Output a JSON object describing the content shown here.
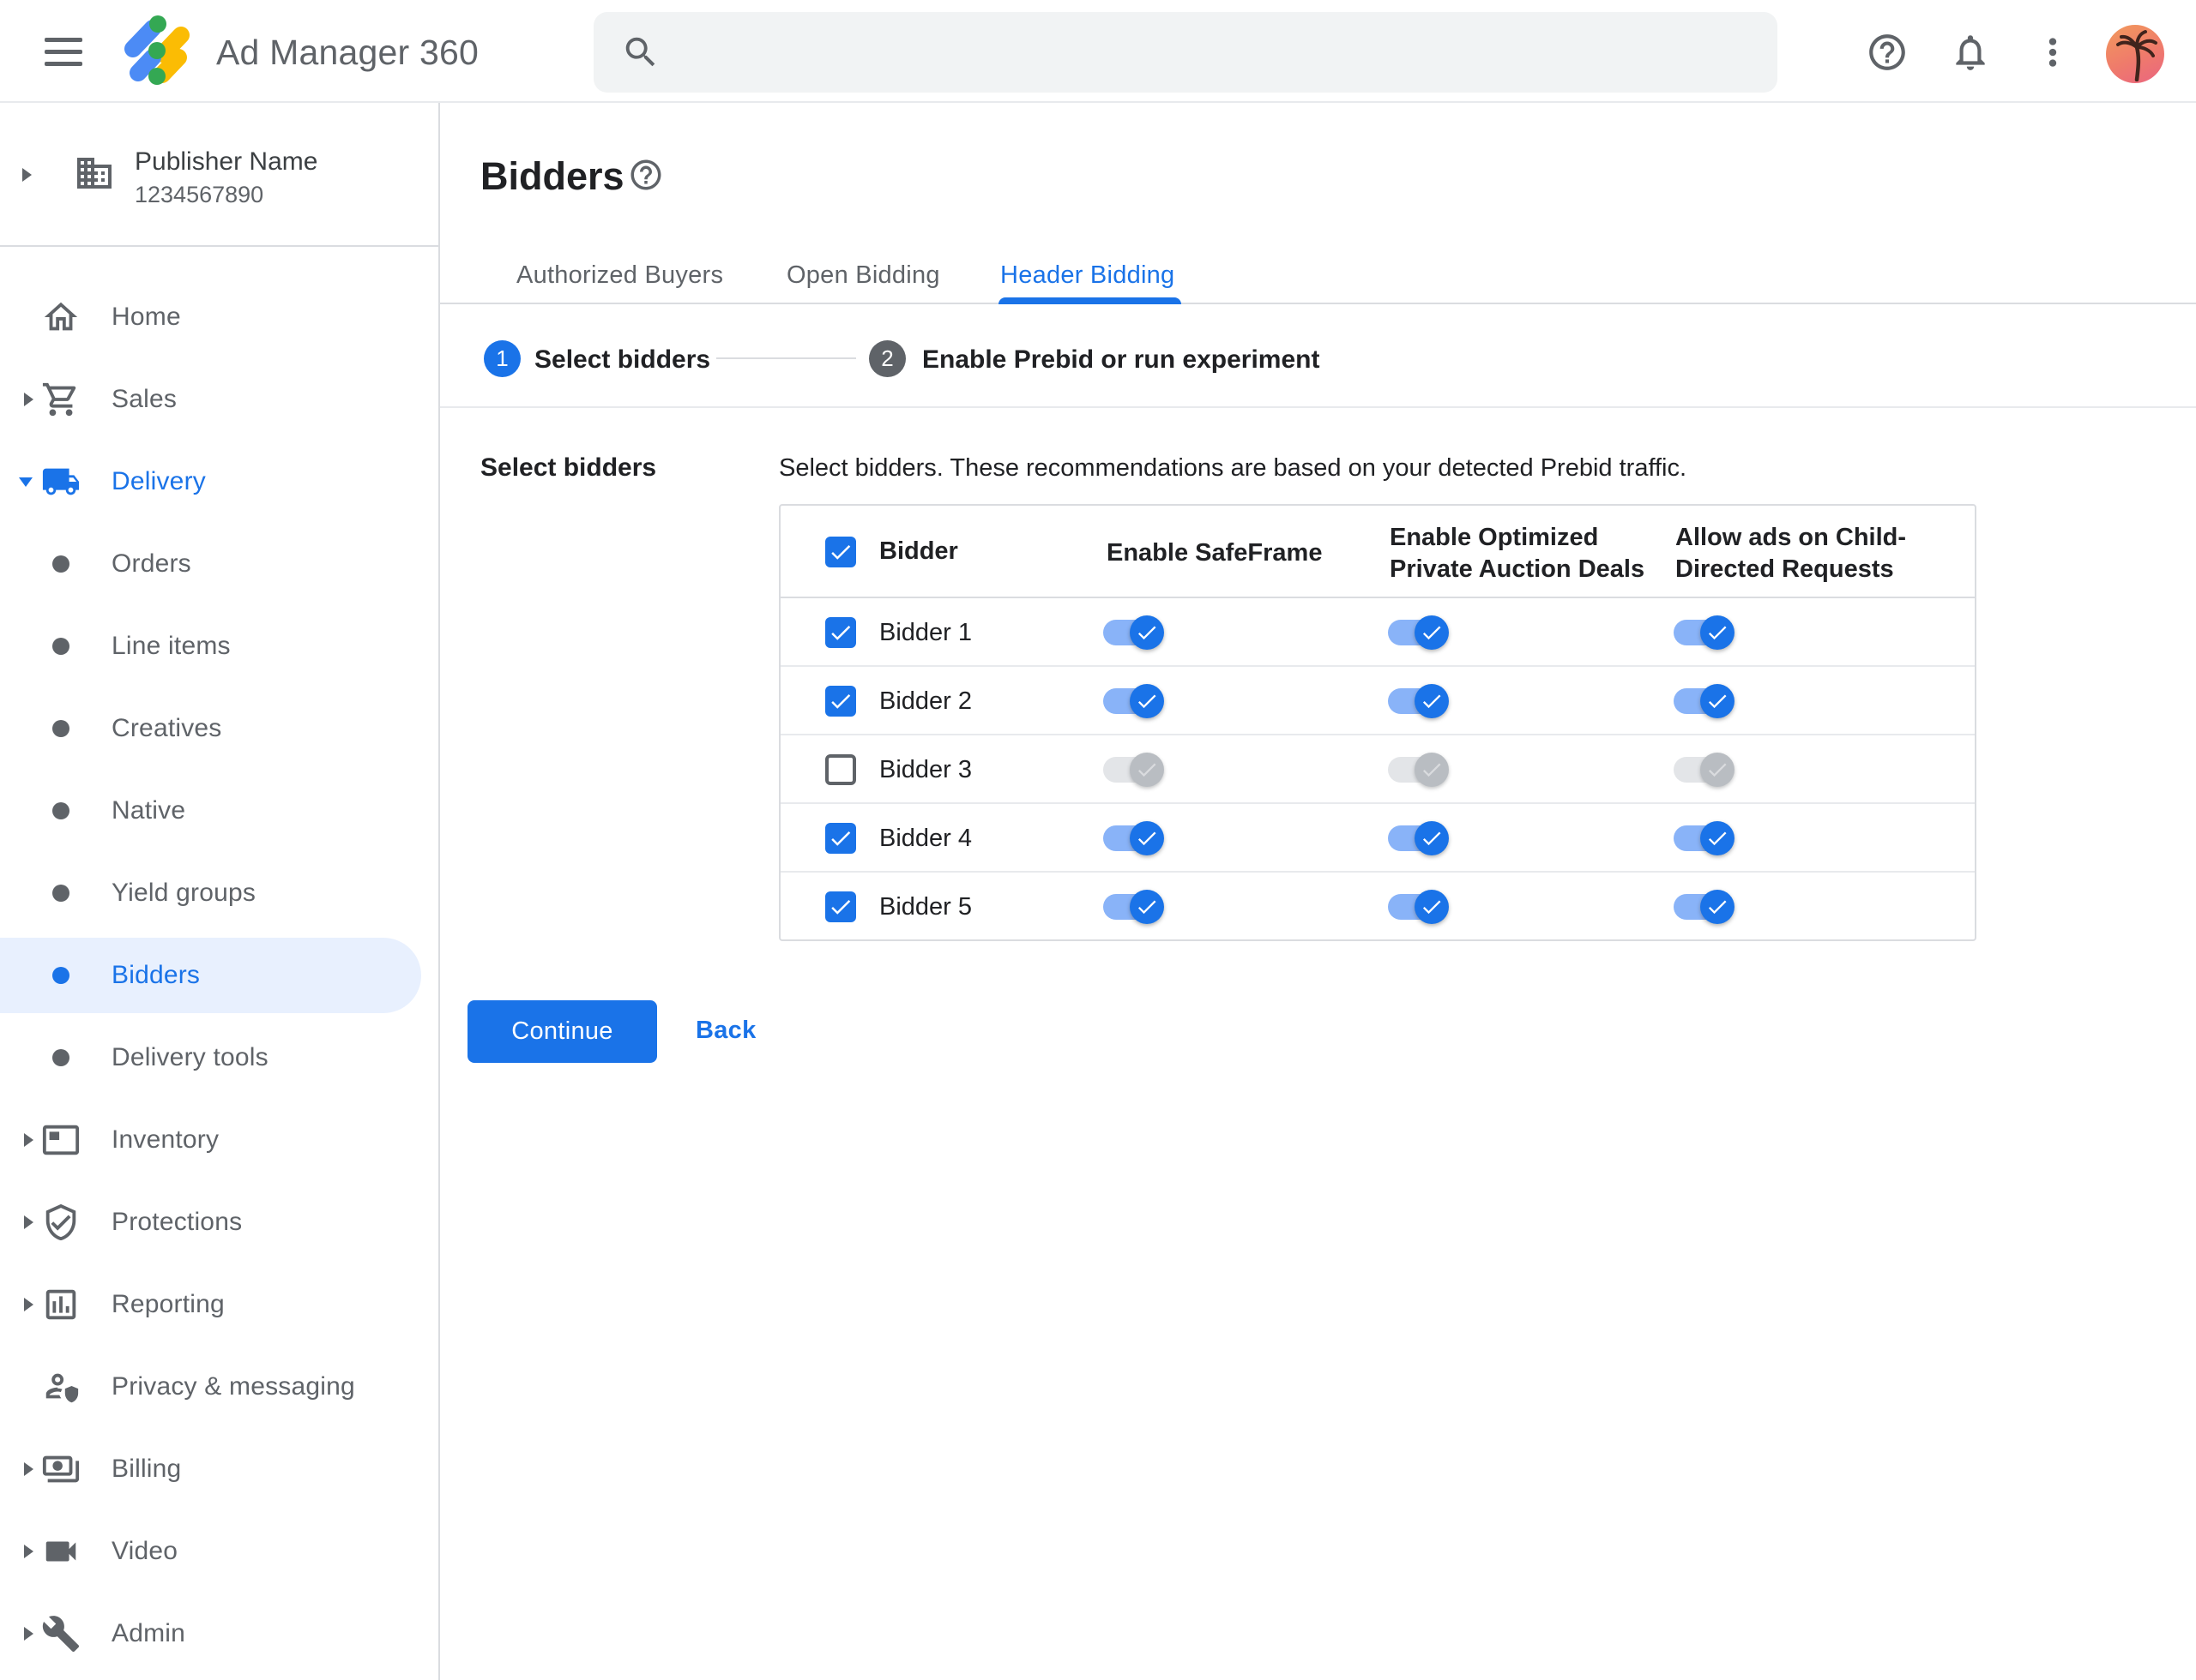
{
  "appbar": {
    "product_name": "Ad Manager 360",
    "menu_icon": "hamburger-menu-icon",
    "search": {
      "value": "",
      "placeholder": ""
    },
    "right_icons": [
      "help-icon",
      "notifications-icon",
      "more-vert-icon",
      "avatar-palm-tree"
    ]
  },
  "sidebar": {
    "publisher": {
      "name": "Publisher Name",
      "id": "1234567890",
      "icon": "building-icon",
      "arrow": "collapsed"
    },
    "items": [
      {
        "label": "Home",
        "icon": "home-icon",
        "arrow": "none",
        "type": "top"
      },
      {
        "label": "Sales",
        "icon": "cart-icon",
        "arrow": "collapsed",
        "type": "top"
      },
      {
        "label": "Delivery",
        "icon": "truck-icon",
        "arrow": "expanded",
        "type": "top",
        "highlight": "blue"
      },
      {
        "label": "Orders",
        "type": "sub"
      },
      {
        "label": "Line items",
        "type": "sub"
      },
      {
        "label": "Creatives",
        "type": "sub"
      },
      {
        "label": "Native",
        "type": "sub"
      },
      {
        "label": "Yield groups",
        "type": "sub"
      },
      {
        "label": "Bidders",
        "type": "sub",
        "selected": true
      },
      {
        "label": "Delivery tools",
        "type": "sub"
      },
      {
        "label": "Inventory",
        "icon": "ad-unit-icon",
        "arrow": "collapsed",
        "type": "top"
      },
      {
        "label": "Protections",
        "icon": "shield-icon",
        "arrow": "collapsed",
        "type": "top"
      },
      {
        "label": "Reporting",
        "icon": "bar-chart-icon",
        "arrow": "collapsed",
        "type": "top"
      },
      {
        "label": "Privacy & messaging",
        "icon": "privacy-icon",
        "arrow": "none",
        "type": "top"
      },
      {
        "label": "Billing",
        "icon": "billing-icon",
        "arrow": "collapsed",
        "type": "top"
      },
      {
        "label": "Video",
        "icon": "video-icon",
        "arrow": "collapsed",
        "type": "top"
      },
      {
        "label": "Admin",
        "icon": "wrench-icon",
        "arrow": "collapsed",
        "type": "top"
      }
    ]
  },
  "main": {
    "page_title": "Bidders",
    "title_help_icon": "help-icon",
    "tabs": [
      {
        "label": "Authorized Buyers",
        "active": false
      },
      {
        "label": "Open Bidding",
        "active": false
      },
      {
        "label": "Header Bidding",
        "active": true
      }
    ],
    "stepper": [
      {
        "number": "1",
        "label": "Select bidders",
        "state": "current"
      },
      {
        "number": "2",
        "label": "Enable Prebid or run experiment",
        "state": "upcoming"
      }
    ],
    "section_label": "Select bidders",
    "description": "Select bidders. These recommendations are based on your detected Prebid traffic.",
    "table": {
      "header_checkbox_checked": true,
      "columns": [
        "Bidder",
        "Enable SafeFrame",
        "Enable Optimized Private Auction Deals",
        "Allow ads on Child-Directed Requests"
      ],
      "rows": [
        {
          "name": "Bidder 1",
          "checked": true,
          "enabled": true,
          "safeframe": true,
          "optimized_deals": true,
          "child_directed": true
        },
        {
          "name": "Bidder 2",
          "checked": true,
          "enabled": true,
          "safeframe": true,
          "optimized_deals": true,
          "child_directed": true
        },
        {
          "name": "Bidder 3",
          "checked": false,
          "enabled": false,
          "safeframe": true,
          "optimized_deals": true,
          "child_directed": true
        },
        {
          "name": "Bidder 4",
          "checked": true,
          "enabled": true,
          "safeframe": true,
          "optimized_deals": true,
          "child_directed": true
        },
        {
          "name": "Bidder 5",
          "checked": true,
          "enabled": true,
          "safeframe": true,
          "optimized_deals": true,
          "child_directed": true
        }
      ]
    },
    "actions": {
      "continue_label": "Continue",
      "back_label": "Back"
    }
  },
  "colors": {
    "accent": "#1a73e8",
    "selected_item_bg": "#e8f0fe",
    "toggle_track_on": "#89b3f8",
    "toggle_track_off": "#e3e5e8",
    "toggle_thumb_off": "#b9bdc2",
    "text_primary": "#202124",
    "text_secondary": "#5f6368",
    "border": "#dadce0",
    "row_border": "#e8eaed",
    "search_bg": "#f1f3f4",
    "logo_blue": "#4c8bf5",
    "logo_yellow": "#fbbc04",
    "logo_green": "#34a853"
  }
}
